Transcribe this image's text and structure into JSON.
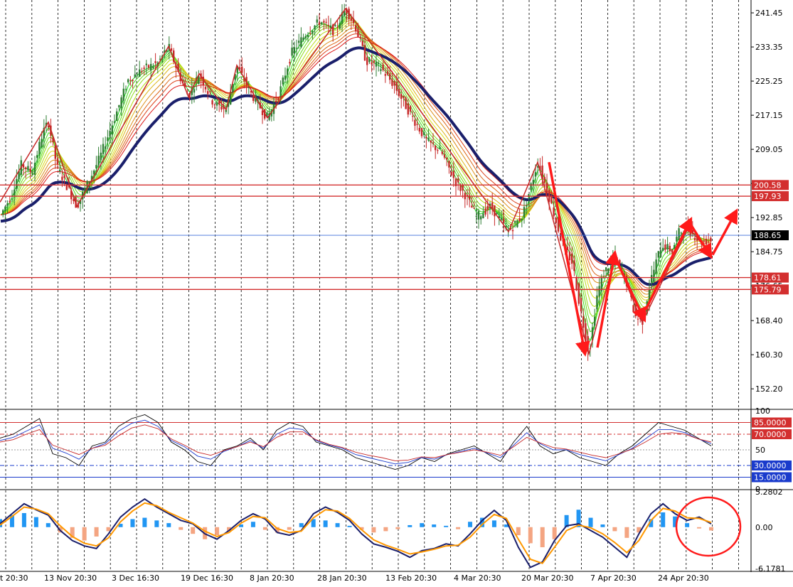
{
  "colors": {
    "background": "#ffffff",
    "grid": "#000000",
    "bull_candle": "#2e7d32",
    "bear_candle": "#c62828",
    "zigzag": "#c62828",
    "slow_ma": "#1a1f6b",
    "hline_red": "#d32f2f",
    "hline_blue": "#3f6fd8",
    "price_label": "#000000",
    "macd_hist_pos": "#2196f3",
    "macd_hist_neg": "#f4a582",
    "macd_fast": "#1a1f6b",
    "macd_signal": "#ff9800",
    "stoch_k": "#000000",
    "stoch_d": "#1a3bcc",
    "stoch_rsi": "#c62828",
    "annotation": "#ff1a1a"
  },
  "chart_data": [
    {
      "type": "candlestick",
      "panel": "price",
      "y_ticks": [
        "241.45",
        "233.35",
        "225.25",
        "217.15",
        "209.05",
        "200.95",
        "192.85",
        "184.75",
        "176.65",
        "168.40",
        "160.30",
        "152.20"
      ],
      "ylim": [
        147.5,
        244.5
      ],
      "x_labels": [
        "t 20:30",
        "13 Nov 20:30",
        "3 Dec 16:30",
        "19 Dec 16:30",
        "8 Jan 20:30",
        "28 Jan 20:30",
        "13 Feb 20:30",
        "4 Mar 20:30",
        "20 Mar 20:30",
        "7 Apr 20:30",
        "24 Apr 20:30"
      ],
      "x_range": [
        0,
        1056
      ],
      "price_path": [
        {
          "x": 0,
          "y": 193.2
        },
        {
          "x": 15,
          "y": 197.8
        },
        {
          "x": 30,
          "y": 205.5
        },
        {
          "x": 45,
          "y": 203.5
        },
        {
          "x": 60,
          "y": 213.0
        },
        {
          "x": 68,
          "y": 215.5
        },
        {
          "x": 80,
          "y": 205.0
        },
        {
          "x": 95,
          "y": 200.0
        },
        {
          "x": 108,
          "y": 195.5
        },
        {
          "x": 122,
          "y": 200.5
        },
        {
          "x": 140,
          "y": 207.0
        },
        {
          "x": 160,
          "y": 216.0
        },
        {
          "x": 180,
          "y": 225.5
        },
        {
          "x": 200,
          "y": 228.0
        },
        {
          "x": 222,
          "y": 229.5
        },
        {
          "x": 237,
          "y": 233.5
        },
        {
          "x": 250,
          "y": 227.5
        },
        {
          "x": 265,
          "y": 221.5
        },
        {
          "x": 280,
          "y": 227.0
        },
        {
          "x": 300,
          "y": 220.0
        },
        {
          "x": 318,
          "y": 218.5
        },
        {
          "x": 333,
          "y": 229.0
        },
        {
          "x": 352,
          "y": 222.5
        },
        {
          "x": 376,
          "y": 216.5
        },
        {
          "x": 392,
          "y": 222.0
        },
        {
          "x": 410,
          "y": 232.0
        },
        {
          "x": 430,
          "y": 236.5
        },
        {
          "x": 450,
          "y": 239.5
        },
        {
          "x": 470,
          "y": 237.0
        },
        {
          "x": 486,
          "y": 242.5
        },
        {
          "x": 500,
          "y": 238.0
        },
        {
          "x": 515,
          "y": 230.0
        },
        {
          "x": 535,
          "y": 228.5
        },
        {
          "x": 555,
          "y": 224.0
        },
        {
          "x": 575,
          "y": 218.0
        },
        {
          "x": 600,
          "y": 211.0
        },
        {
          "x": 620,
          "y": 208.5
        },
        {
          "x": 640,
          "y": 201.5
        },
        {
          "x": 655,
          "y": 198.0
        },
        {
          "x": 670,
          "y": 193.0
        },
        {
          "x": 690,
          "y": 195.5
        },
        {
          "x": 715,
          "y": 189.5
        },
        {
          "x": 735,
          "y": 193.5
        },
        {
          "x": 756,
          "y": 206.0
        },
        {
          "x": 770,
          "y": 199.0
        },
        {
          "x": 790,
          "y": 187.0
        },
        {
          "x": 805,
          "y": 182.0
        },
        {
          "x": 815,
          "y": 172.0
        },
        {
          "x": 828,
          "y": 160.5
        },
        {
          "x": 840,
          "y": 175.0
        },
        {
          "x": 850,
          "y": 180.0
        },
        {
          "x": 865,
          "y": 183.5
        },
        {
          "x": 880,
          "y": 178.0
        },
        {
          "x": 893,
          "y": 169.5
        },
        {
          "x": 903,
          "y": 168.0
        },
        {
          "x": 915,
          "y": 178.0
        },
        {
          "x": 930,
          "y": 186.5
        },
        {
          "x": 945,
          "y": 185.0
        },
        {
          "x": 955,
          "y": 189.5
        },
        {
          "x": 968,
          "y": 190.0
        },
        {
          "x": 985,
          "y": 187.0
        },
        {
          "x": 1000,
          "y": 187.5
        }
      ],
      "zigzag_points": [
        {
          "x": 0,
          "y": 196.5
        },
        {
          "x": 68,
          "y": 215.5
        },
        {
          "x": 108,
          "y": 195.5
        },
        {
          "x": 237,
          "y": 233.5
        },
        {
          "x": 265,
          "y": 221.5
        },
        {
          "x": 280,
          "y": 227.0
        },
        {
          "x": 318,
          "y": 218.5
        },
        {
          "x": 333,
          "y": 229.0
        },
        {
          "x": 376,
          "y": 216.5
        },
        {
          "x": 486,
          "y": 242.5
        },
        {
          "x": 715,
          "y": 189.5
        },
        {
          "x": 756,
          "y": 206.0
        },
        {
          "x": 828,
          "y": 160.5
        },
        {
          "x": 865,
          "y": 183.5
        },
        {
          "x": 903,
          "y": 168.0
        },
        {
          "x": 968,
          "y": 190.5
        },
        {
          "x": 1000,
          "y": 184.0
        }
      ],
      "horizontal_lines": [
        {
          "value": 200.58,
          "label": "200.58",
          "color": "#d32f2f"
        },
        {
          "value": 197.93,
          "label": "197.93",
          "color": "#d32f2f"
        },
        {
          "value": 188.65,
          "label": "188.65",
          "color": "#3f6fd8",
          "current_price": true
        },
        {
          "value": 178.61,
          "label": "178.61",
          "color": "#d32f2f"
        },
        {
          "value": 175.79,
          "label": "175.79",
          "color": "#d32f2f"
        }
      ],
      "annotations": "red arrows drawn down from ~206 to ~161, up to ~184, down to ~169, up to ~190, down to ~184, up to ~193"
    },
    {
      "type": "line",
      "panel": "oscillator",
      "ylim": [
        0,
        100
      ],
      "y_ticks": [
        "100",
        "50",
        "0"
      ],
      "levels": [
        {
          "value": 85,
          "label": "85.0000",
          "color": "#d32f2f"
        },
        {
          "value": 70,
          "label": "70.0000",
          "color": "#d32f2f"
        },
        {
          "value": 30,
          "label": "30.0000",
          "color": "#1a3bcc"
        },
        {
          "value": 15,
          "label": "15.0000",
          "color": "#1a3bcc"
        }
      ],
      "series": [
        {
          "color": "#000000",
          "values": [
            65,
            70,
            80,
            90,
            45,
            40,
            30,
            55,
            60,
            80,
            90,
            95,
            85,
            60,
            50,
            35,
            30,
            50,
            55,
            65,
            50,
            75,
            85,
            80,
            60,
            55,
            50,
            40,
            35,
            30,
            25,
            30,
            40,
            35,
            45,
            50,
            55,
            45,
            35,
            60,
            80,
            55,
            45,
            50,
            40,
            35,
            30,
            45,
            55,
            70,
            85,
            80,
            75,
            65,
            55
          ]
        },
        {
          "color": "#1a3bcc",
          "values": [
            62,
            66,
            74,
            82,
            52,
            46,
            38,
            52,
            58,
            74,
            84,
            88,
            80,
            62,
            54,
            42,
            38,
            48,
            54,
            62,
            52,
            70,
            78,
            76,
            62,
            56,
            52,
            44,
            40,
            36,
            32,
            34,
            40,
            38,
            44,
            48,
            52,
            46,
            40,
            56,
            72,
            58,
            50,
            50,
            44,
            40,
            36,
            44,
            52,
            64,
            76,
            76,
            72,
            64,
            58
          ]
        },
        {
          "color": "#c62828",
          "values": [
            60,
            63,
            70,
            76,
            56,
            50,
            44,
            52,
            56,
            68,
            78,
            82,
            77,
            64,
            56,
            47,
            43,
            49,
            54,
            60,
            54,
            66,
            73,
            73,
            63,
            57,
            53,
            47,
            43,
            40,
            36,
            37,
            41,
            40,
            44,
            47,
            50,
            47,
            43,
            54,
            66,
            59,
            53,
            51,
            47,
            43,
            40,
            45,
            51,
            60,
            70,
            72,
            70,
            64,
            60
          ]
        }
      ]
    },
    {
      "type": "bar+line",
      "panel": "macd",
      "y_ticks": [
        "5.2802",
        "0.00",
        "-6.1781"
      ],
      "ylim": [
        -6.1781,
        5.2802
      ],
      "histogram": [
        1.2,
        1.8,
        2.1,
        1.5,
        0.6,
        -0.8,
        -1.6,
        -2.0,
        -1.4,
        -0.6,
        0.5,
        1.2,
        1.4,
        1.0,
        0.6,
        -0.4,
        -1.0,
        -1.8,
        -1.2,
        -0.6,
        0.4,
        0.8,
        -0.4,
        -0.8,
        -0.4,
        0.6,
        1.2,
        1.0,
        0.6,
        0.2,
        -0.4,
        -0.8,
        -0.6,
        -0.3,
        0.3,
        0.6,
        0.4,
        0.2,
        -0.3,
        0.8,
        1.4,
        1.0,
        0.4,
        -1.2,
        -2.4,
        -3.0,
        -1.8,
        1.8,
        2.6,
        1.4,
        0.4,
        -0.6,
        -1.6,
        -0.8,
        1.2,
        2.2,
        1.6,
        0.6,
        -0.2,
        -0.5
      ],
      "series": [
        {
          "color": "#1a1f6b",
          "values": [
            0.5,
            2.0,
            3.5,
            2.6,
            1.8,
            -0.5,
            -2.0,
            -2.8,
            -3.2,
            -1.0,
            1.5,
            3.0,
            4.2,
            3.0,
            2.0,
            1.0,
            0.5,
            -1.0,
            -1.8,
            -0.5,
            1.0,
            2.0,
            1.2,
            -0.8,
            -1.2,
            -0.5,
            2.0,
            3.0,
            2.2,
            1.0,
            -1.0,
            -2.5,
            -3.0,
            -3.6,
            -4.5,
            -3.5,
            -3.2,
            -2.5,
            -2.8,
            -1.0,
            1.0,
            2.5,
            1.0,
            -3.0,
            -6.0,
            -5.2,
            -2.0,
            0.2,
            0.5,
            -0.5,
            -1.5,
            -3.0,
            -4.5,
            -1.0,
            2.0,
            3.5,
            2.0,
            1.0,
            1.5,
            0.5
          ]
        },
        {
          "color": "#ff9800",
          "values": [
            0.3,
            1.6,
            3.0,
            2.7,
            2.0,
            0.2,
            -1.4,
            -2.4,
            -2.8,
            -1.6,
            0.8,
            2.4,
            3.6,
            3.2,
            2.2,
            1.4,
            0.6,
            -0.6,
            -1.4,
            -0.8,
            0.6,
            1.6,
            1.4,
            -0.2,
            -0.8,
            -0.6,
            1.4,
            2.6,
            2.4,
            1.3,
            -0.4,
            -1.9,
            -2.7,
            -3.3,
            -4.0,
            -3.7,
            -3.3,
            -2.8,
            -2.7,
            -1.5,
            0.4,
            1.9,
            1.3,
            -1.8,
            -4.8,
            -5.4,
            -3.0,
            -0.5,
            0.3,
            -0.1,
            -1.0,
            -2.3,
            -3.8,
            -2.0,
            1.0,
            2.8,
            2.4,
            1.4,
            1.3,
            0.7
          ]
        }
      ]
    }
  ]
}
